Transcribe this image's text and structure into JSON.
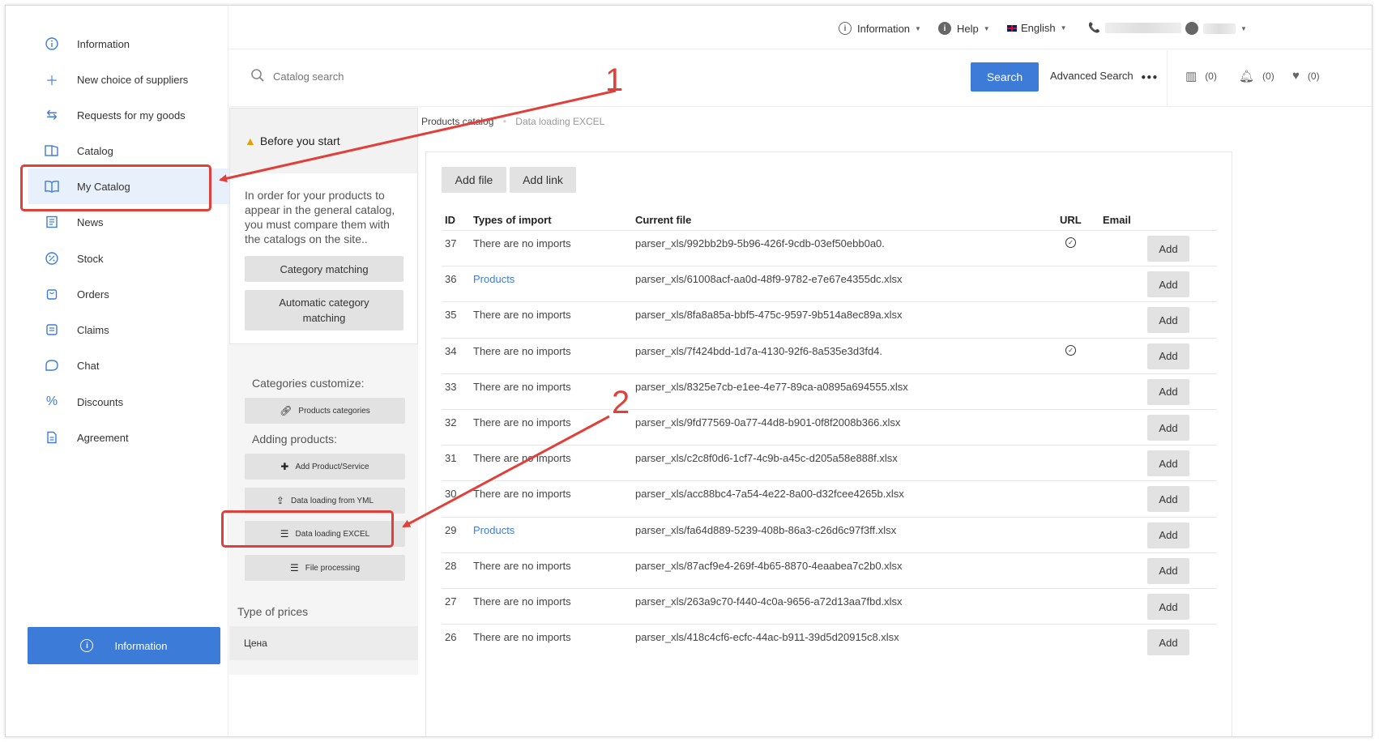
{
  "sidebar": {
    "items": [
      {
        "label": "Information",
        "icon": "info-icon"
      },
      {
        "label": "New choice of suppliers",
        "icon": "plus-icon"
      },
      {
        "label": "Requests for my goods",
        "icon": "requests-icon"
      },
      {
        "label": "Catalog",
        "icon": "catalog-icon"
      },
      {
        "label": "My Catalog",
        "icon": "book-icon",
        "active": true
      },
      {
        "label": "News",
        "icon": "news-icon"
      },
      {
        "label": "Stock",
        "icon": "percent-badge-icon"
      },
      {
        "label": "Orders",
        "icon": "bag-icon"
      },
      {
        "label": "Claims",
        "icon": "claims-icon"
      },
      {
        "label": "Chat",
        "icon": "chat-icon"
      },
      {
        "label": "Discounts",
        "icon": "percent-icon"
      },
      {
        "label": "Agreement",
        "icon": "document-icon"
      }
    ],
    "info_button": "Information"
  },
  "header": {
    "information": "Information",
    "help": "Help",
    "language": "English"
  },
  "search": {
    "placeholder": "Catalog search",
    "button": "Search",
    "advanced": "Advanced Search",
    "counters": {
      "compare": "(0)",
      "notifications": "(0)",
      "favorites": "(0)"
    }
  },
  "before_start": {
    "title": "Before you start",
    "text": "In order for your products to appear in the general catalog, you must compare them with the catalogs on the site..",
    "category_matching": "Category matching",
    "auto_matching": "Automatic category matching"
  },
  "customize": {
    "label": "Categories customize:",
    "products_categories": "Products categories"
  },
  "adding": {
    "label": "Adding products:",
    "add_product": "Add Product/Service",
    "yml": "Data loading from YML",
    "excel": "Data loading EXCEL",
    "file_processing": "File processing"
  },
  "prices": {
    "label": "Type of prices",
    "item": "Цена"
  },
  "breadcrumb": {
    "parent": "Products catalog",
    "current": "Data loading EXCEL"
  },
  "toolbar": {
    "add_file": "Add file",
    "add_link": "Add link"
  },
  "table": {
    "headers": {
      "id": "ID",
      "type": "Types of import",
      "file": "Current file",
      "url": "URL",
      "email": "Email"
    },
    "add_label": "Add",
    "rows": [
      {
        "id": "37",
        "type": "There are no imports",
        "type_link": false,
        "file": "parser_xls/992bb2b9-5b96-426f-9cdb-03ef50ebb0a0.",
        "url_check": true
      },
      {
        "id": "36",
        "type": "Products",
        "type_link": true,
        "file": "parser_xls/61008acf-aa0d-48f9-9782-e7e67e4355dc.xlsx",
        "url_check": false
      },
      {
        "id": "35",
        "type": "There are no imports",
        "type_link": false,
        "file": "parser_xls/8fa8a85a-bbf5-475c-9597-9b514a8ec89a.xlsx",
        "url_check": false
      },
      {
        "id": "34",
        "type": "There are no imports",
        "type_link": false,
        "file": "parser_xls/7f424bdd-1d7a-4130-92f6-8a535e3d3fd4.",
        "url_check": true
      },
      {
        "id": "33",
        "type": "There are no imports",
        "type_link": false,
        "file": "parser_xls/8325e7cb-e1ee-4e77-89ca-a0895a694555.xlsx",
        "url_check": false
      },
      {
        "id": "32",
        "type": "There are no imports",
        "type_link": false,
        "file": "parser_xls/9fd77569-0a77-44d8-b901-0f8f2008b366.xlsx",
        "url_check": false
      },
      {
        "id": "31",
        "type": "There are no imports",
        "type_link": false,
        "file": "parser_xls/c2c8f0d6-1cf7-4c9b-a45c-d205a58e888f.xlsx",
        "url_check": false
      },
      {
        "id": "30",
        "type": "There are no imports",
        "type_link": false,
        "file": "parser_xls/acc88bc4-7a54-4e22-8a00-d32fcee4265b.xlsx",
        "url_check": false
      },
      {
        "id": "29",
        "type": "Products",
        "type_link": true,
        "file": "parser_xls/fa64d889-5239-408b-86a3-c26d6c97f3ff.xlsx",
        "url_check": false
      },
      {
        "id": "28",
        "type": "There are no imports",
        "type_link": false,
        "file": "parser_xls/87acf9e4-269f-4b65-8870-4eaabea7c2b0.xlsx",
        "url_check": false
      },
      {
        "id": "27",
        "type": "There are no imports",
        "type_link": false,
        "file": "parser_xls/263a9c70-f440-4c0a-9656-a72d13aa7fbd.xlsx",
        "url_check": false
      },
      {
        "id": "26",
        "type": "There are no imports",
        "type_link": false,
        "file": "parser_xls/418c4cf6-ecfc-44ac-b911-39d5d20915c8.xlsx",
        "url_check": false
      }
    ]
  },
  "annotations": {
    "one": "1",
    "two": "2",
    "color": "#e0403a"
  }
}
